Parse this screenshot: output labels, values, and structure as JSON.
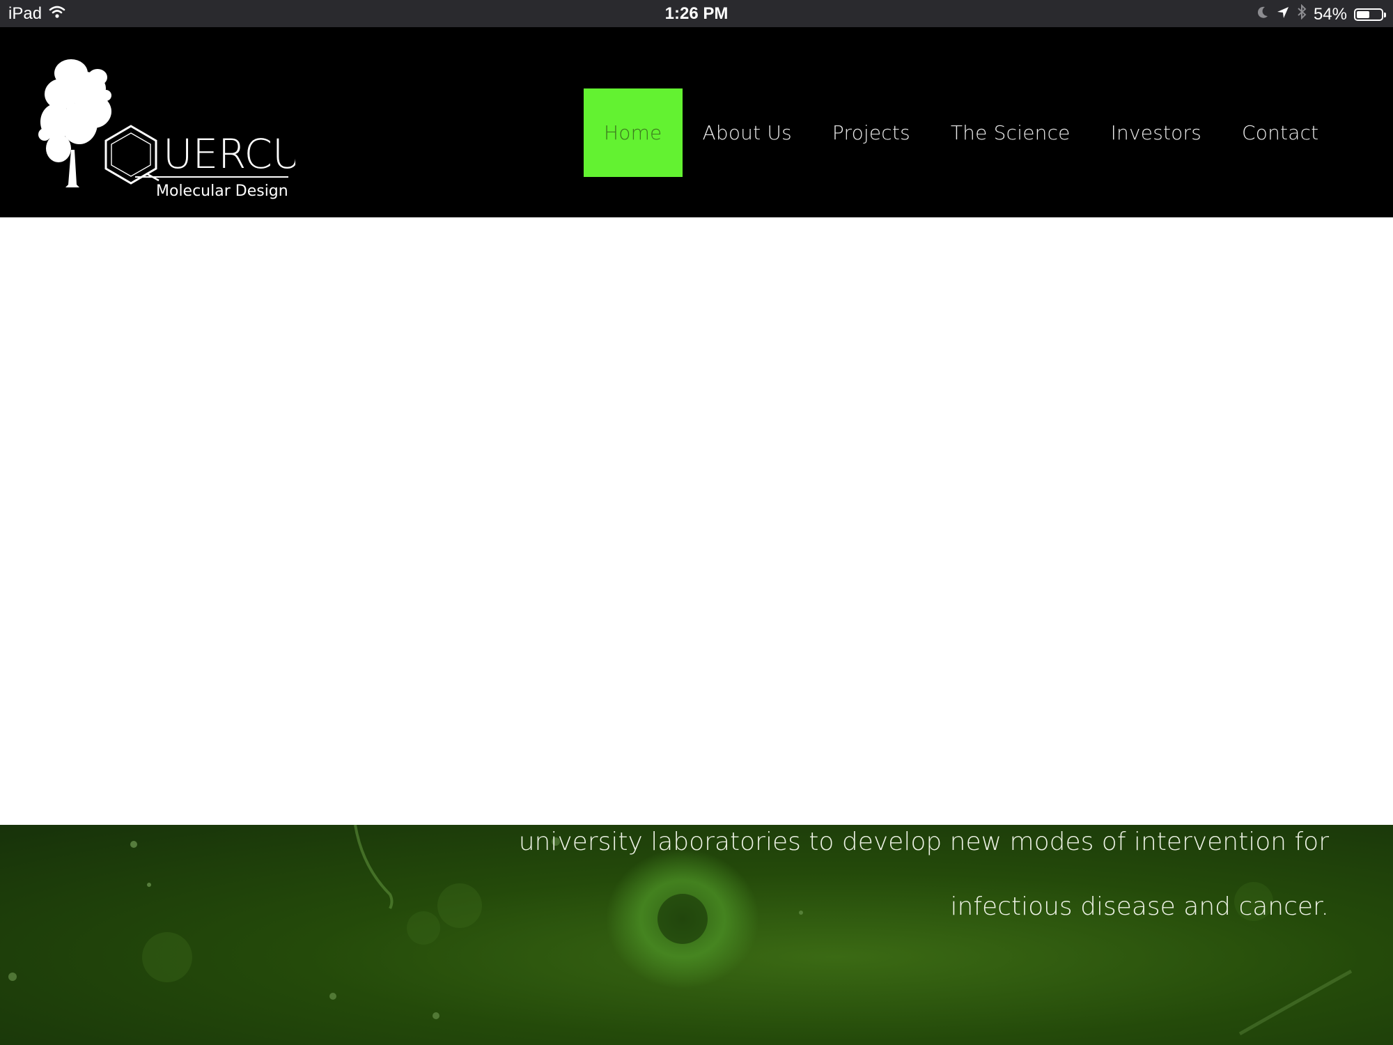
{
  "status_bar": {
    "device": "iPad",
    "time": "1:26 PM",
    "battery": "54%",
    "battery_level": 0.54,
    "icons": [
      "wifi-icon",
      "moon-icon",
      "location-arrow-icon",
      "bluetooth-icon",
      "battery-icon"
    ]
  },
  "header": {
    "logo": {
      "brand": "UERCUS",
      "tagline": "Molecular Design"
    },
    "nav": [
      {
        "label": "Home",
        "active": true
      },
      {
        "label": "About Us",
        "active": false
      },
      {
        "label": "Projects",
        "active": false
      },
      {
        "label": "The Science",
        "active": false
      },
      {
        "label": "Investors",
        "active": false
      },
      {
        "label": "Contact",
        "active": false
      }
    ],
    "colors": {
      "background": "#000000",
      "active_item": "#63f231",
      "active_text": "#3c7a1f"
    }
  },
  "hero": {
    "lines": [
      "university laboratories to develop new modes of intervention for",
      "infectious disease and cancer."
    ],
    "colors": {
      "background": "#244a0a"
    }
  }
}
